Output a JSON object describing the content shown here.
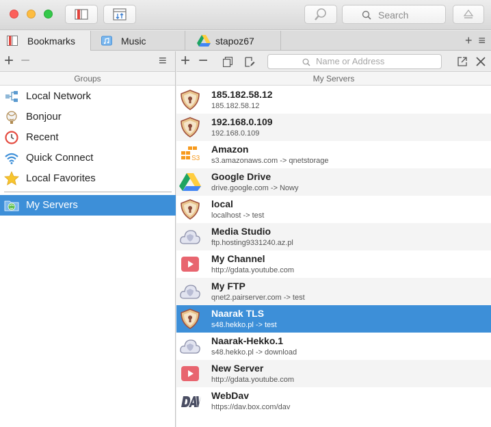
{
  "toolbar": {
    "search_placeholder": "Search"
  },
  "tabs": [
    {
      "label": "Bookmarks",
      "icon": "bookmarks-icon"
    },
    {
      "label": "Music",
      "icon": "music-folder-icon"
    },
    {
      "label": "stapoz67",
      "icon": "google-drive-icon"
    }
  ],
  "tabbar_actions": "+ ≡",
  "groups_pane": {
    "header": "Groups",
    "items": [
      {
        "label": "Local Network",
        "icon": "network-icon"
      },
      {
        "label": "Bonjour",
        "icon": "bonjour-icon"
      },
      {
        "label": "Recent",
        "icon": "recent-icon"
      },
      {
        "label": "Quick Connect",
        "icon": "wifi-icon"
      },
      {
        "label": "Local Favorites",
        "icon": "star-icon"
      },
      {
        "label": "My Servers",
        "icon": "my-servers-icon",
        "selected": true
      }
    ]
  },
  "servers_pane": {
    "header": "My Servers",
    "address_placeholder": "Name or Address",
    "servers": [
      {
        "name": "185.182.58.12",
        "address": "185.182.58.12",
        "icon": "shield-icon"
      },
      {
        "name": "192.168.0.109",
        "address": "192.168.0.109",
        "icon": "shield-icon"
      },
      {
        "name": "Amazon",
        "address": "s3.amazonaws.com -> qnetstorage",
        "icon": "amazon-s3-icon"
      },
      {
        "name": "Google Drive",
        "address": "drive.google.com -> Nowy",
        "icon": "google-drive-icon"
      },
      {
        "name": "local",
        "address": "localhost -> test",
        "icon": "shield-icon"
      },
      {
        "name": "Media Studio",
        "address": "ftp.hosting9331240.az.pl",
        "icon": "cloud-icon"
      },
      {
        "name": "My Channel",
        "address": "http://gdata.youtube.com",
        "icon": "youtube-icon"
      },
      {
        "name": "My FTP",
        "address": "qnet2.pairserver.com -> test",
        "icon": "cloud-icon"
      },
      {
        "name": "Naarak TLS",
        "address": "s48.hekko.pl -> test",
        "icon": "shield-icon",
        "selected": true
      },
      {
        "name": "Naarak-Hekko.1",
        "address": "s48.hekko.pl -> download",
        "icon": "cloud-icon"
      },
      {
        "name": "New Server",
        "address": "http://gdata.youtube.com",
        "icon": "youtube-icon"
      },
      {
        "name": "WebDav",
        "address": "https://dav.box.com/dav",
        "icon": "dav-icon"
      }
    ]
  },
  "colors": {
    "selection": "#3d8fd8",
    "shield": "#e8c48c",
    "youtube": "#e8656f",
    "drive_green": "#1da462",
    "drive_yellow": "#ffcd40",
    "drive_blue": "#4285f4"
  }
}
